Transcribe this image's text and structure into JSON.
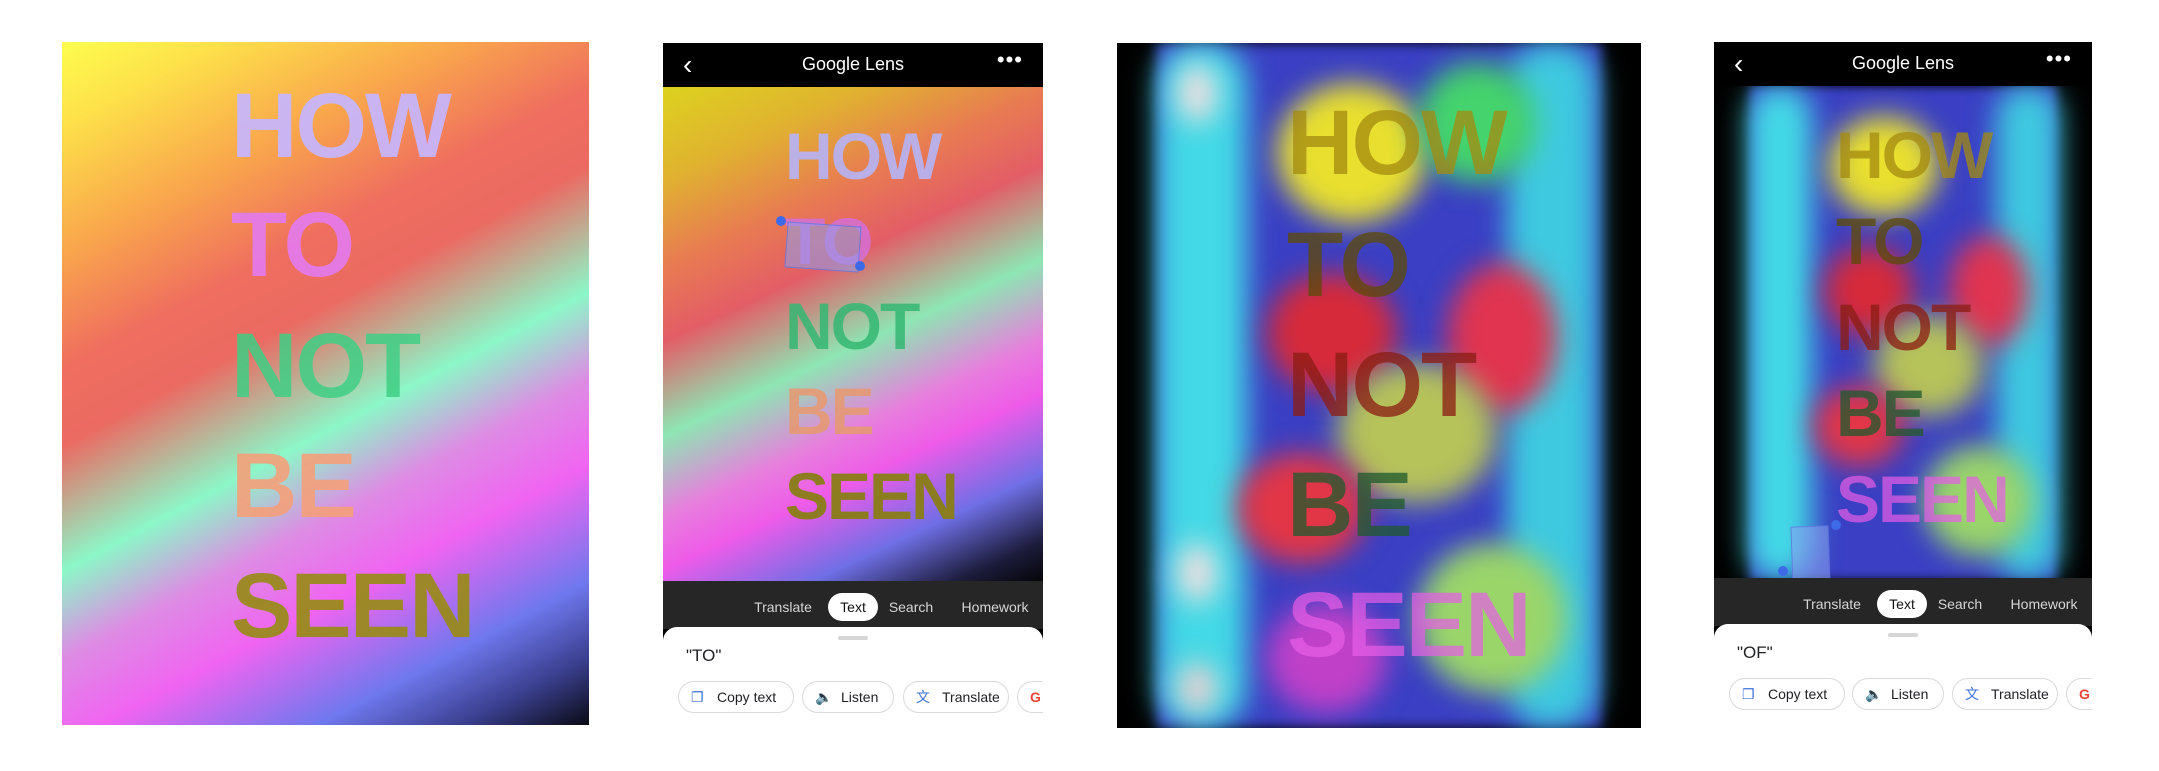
{
  "poster": {
    "lines": [
      "HOW",
      "TO",
      "NOT",
      "BE",
      "SEEN"
    ]
  },
  "lens": {
    "title": "Google Lens",
    "back_icon": "‹",
    "more_icon": "•••",
    "tabs": [
      "Translate",
      "Text",
      "Search",
      "Homework"
    ],
    "active_tab": "Text",
    "actions": [
      {
        "label": "Copy text",
        "icon": "copy-icon"
      },
      {
        "label": "Listen",
        "icon": "speaker-icon"
      },
      {
        "label": "Translate",
        "icon": "translate-icon"
      }
    ],
    "google_chip_glyph": "G"
  },
  "screens": [
    {
      "selected_text": "\"TO\""
    },
    {
      "selected_text": "\"OF\""
    }
  ],
  "colors": {
    "accent_blue": "#3d6be8",
    "sheet_bg": "#ffffff",
    "tabs_bg": "#262626"
  }
}
